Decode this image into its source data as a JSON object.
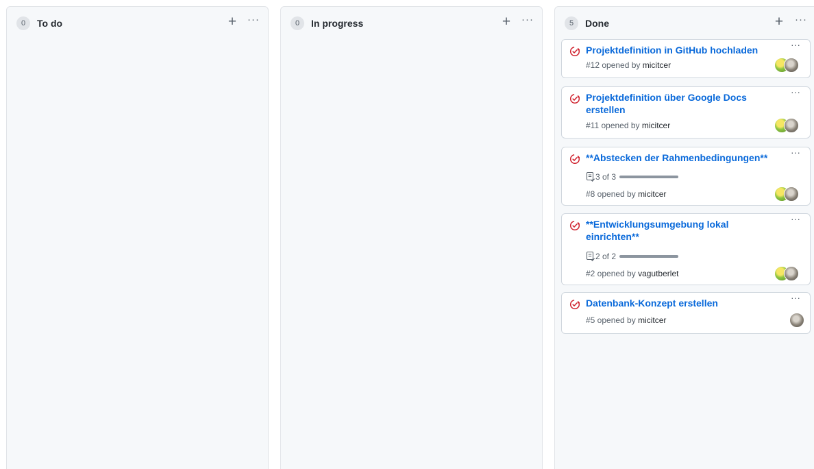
{
  "columns": [
    {
      "count": "0",
      "title": "To do",
      "add_icon": "plus-icon",
      "more_icon": "kebab-horizontal-icon",
      "cards": []
    },
    {
      "count": "0",
      "title": "In progress",
      "add_icon": "plus-icon",
      "more_icon": "kebab-horizontal-icon",
      "cards": []
    },
    {
      "count": "5",
      "title": "Done",
      "add_icon": "plus-icon",
      "more_icon": "kebab-horizontal-icon",
      "cards": [
        {
          "title": "Projektdefinition in GitHub hochladen",
          "meta_prefix": "#12 opened by ",
          "user": "micitcer",
          "status_icon": "issue-closed-icon"
        },
        {
          "title": "Projektdefinition über Google Docs erstellen",
          "meta_prefix": "#11 opened by ",
          "user": "micitcer",
          "status_icon": "issue-closed-icon"
        },
        {
          "title": "**Abstecken der Rahmenbedingungen**",
          "progress_text": "3 of 3",
          "progress_fraction": 1.0,
          "meta_prefix": "#8 opened by ",
          "user": "micitcer",
          "status_icon": "issue-closed-icon"
        },
        {
          "title": "**Entwicklungsumgebung lokal einrichten**",
          "progress_text": "2 of 2",
          "progress_fraction": 1.0,
          "meta_prefix": "#2 opened by ",
          "user": "vagutberlet",
          "status_icon": "issue-closed-icon"
        },
        {
          "title": "Datenbank-Konzept erstellen",
          "meta_prefix": "#5 opened by ",
          "user": "micitcer",
          "status_icon": "issue-closed-icon"
        }
      ]
    }
  ],
  "more_glyph": "···",
  "add_glyph": "+",
  "colors": {
    "issue_closed": "#cf222e",
    "link": "#0969da",
    "column_bg": "#f6f8fa",
    "progress_bar": "#8c959f"
  }
}
